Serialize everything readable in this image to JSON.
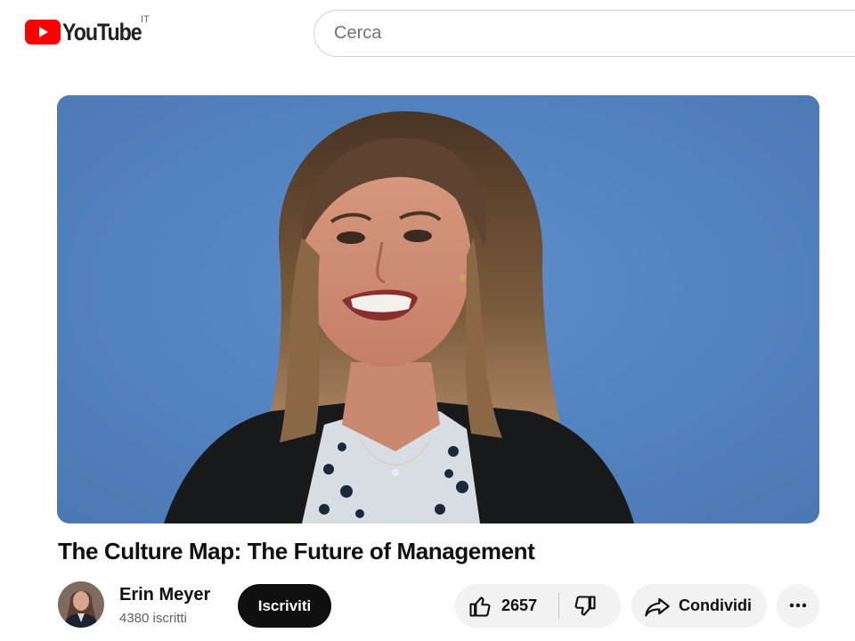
{
  "header": {
    "logo_text": "YouTube",
    "country_code": "IT",
    "search_placeholder": "Cerca",
    "search_value": ""
  },
  "video": {
    "title": "The Culture Map: The Future of Management"
  },
  "owner": {
    "channel_name": "Erin Meyer",
    "subscribers": "4380 iscritti",
    "subscribe_label": "Iscriviti"
  },
  "actions": {
    "like_count": "2657",
    "share_label": "Condividi"
  },
  "icons": {
    "logo": "youtube-play-icon",
    "like": "thumbs-up-icon",
    "dislike": "thumbs-down-icon",
    "share": "share-arrow-icon",
    "more": "more-horizontal-icon"
  },
  "colors": {
    "brand_red": "#ff0000",
    "player_backdrop": "#5585c0",
    "subscribe_bg": "#0f0f0f",
    "pill_bg": "#f2f2f2"
  }
}
